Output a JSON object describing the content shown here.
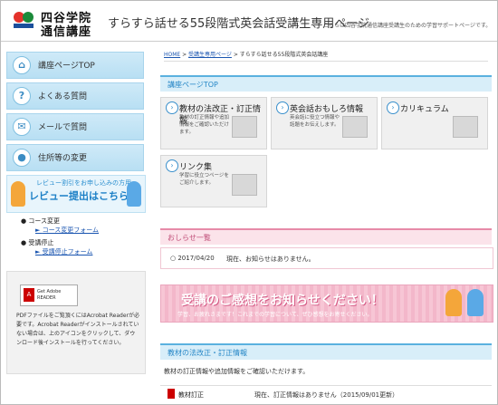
{
  "header": {
    "logo_line1": "四谷学院",
    "logo_line2": "通信講座",
    "title": "すらすら話せる55段階式英会話受講生専用ページ",
    "description": "こちらは四谷学院通信講座受講生のための学習サポートページです。"
  },
  "sidebar": {
    "items": [
      {
        "label": "講座ページTOP",
        "icon": "home-icon",
        "glyph": "⌂"
      },
      {
        "label": "よくある質問",
        "icon": "question-icon",
        "glyph": "?"
      },
      {
        "label": "メールで質問",
        "icon": "mail-icon",
        "glyph": "✉"
      },
      {
        "label": "住所等の変更",
        "icon": "person-icon",
        "glyph": "●"
      }
    ],
    "review_small": "レビュー割引をお申し込みの方用",
    "review_big": "レビュー提出はこちら",
    "links": [
      {
        "heading": "コース変更",
        "link": "コース変更フォーム"
      },
      {
        "heading": "受講停止",
        "link": "受講停止フォーム"
      }
    ],
    "acrobat_label": "Get Adobe READER",
    "acrobat_text": "PDFファイルをご覧頂くにはAcrobat Readerが必要です。Acrobat Readerがインストールされていない場合は、上のアイコンをクリックして、ダウンロード後インストールを行ってください。"
  },
  "breadcrumb": {
    "home": "HOME",
    "sep": " > ",
    "level2": "受講生専用ページ",
    "current": "すらすら話せる55段階式英会話講座"
  },
  "top_section": {
    "title": "講座ページTOP",
    "cards": [
      {
        "title": "教材の法改正・訂正情報",
        "desc": "教材の訂正情報や追加情報をご確認いただけます。"
      },
      {
        "title": "英会話おもしろ情報",
        "desc": "英会話に役立つ情報や話題をお伝えします。"
      },
      {
        "title": "カリキュラム",
        "desc": ""
      },
      {
        "title": "リンク集",
        "desc": "学習に役立つページをご紹介します。"
      }
    ]
  },
  "news": {
    "title": "おしらせ一覧",
    "date": "2017/04/20",
    "text": "現在、お知らせはありません。"
  },
  "banner": {
    "title": "受講のご感想をお知らせください！",
    "subtitle": "学習、お疲れさまです！これまでの学習について、ぜひ感想をお寄せください。"
  },
  "errata": {
    "title": "教材の法改正・訂正情報",
    "intro": "教材の訂正情報や追加情報をご確認いただけます。",
    "row_label": "教材訂正",
    "row_value": "現在、訂正情報はありません（2015/09/01更新）"
  },
  "colors": {
    "accent_blue": "#2586c6",
    "accent_pink": "#c04d78"
  }
}
